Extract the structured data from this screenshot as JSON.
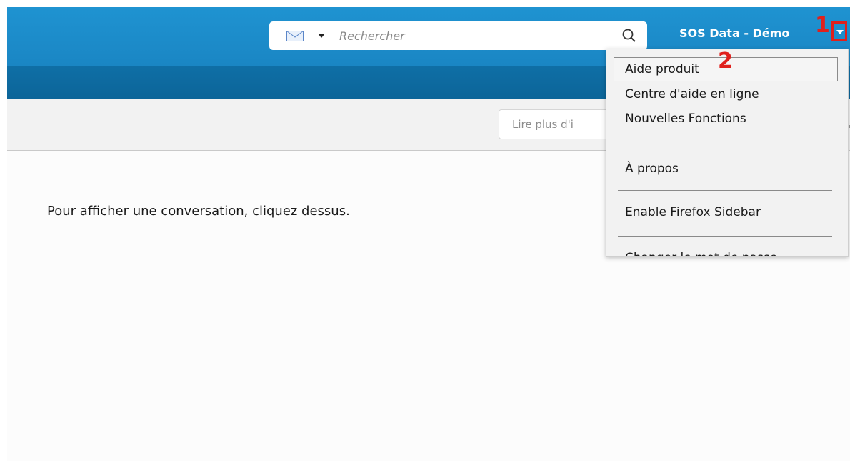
{
  "header": {
    "user_name": "SOS Data - Démo",
    "search": {
      "placeholder": "Rechercher",
      "scope_icon": "mail-icon"
    }
  },
  "annotations": {
    "step1": "1",
    "step2": "2",
    "color": "#e0201c"
  },
  "toolbar": {
    "read_more_label": "Lire plus d'i"
  },
  "main": {
    "empty_message": "Pour afficher une conversation, cliquez dessus."
  },
  "menu": {
    "items": [
      {
        "label": "Aide produit"
      },
      {
        "label": "Centre d'aide en ligne"
      },
      {
        "label": "Nouvelles Fonctions"
      },
      {
        "label": "À propos"
      },
      {
        "label": "Enable Firefox Sidebar"
      },
      {
        "label": "Changer le mot de passe"
      }
    ]
  },
  "colors": {
    "header": "#1f93d1",
    "subheader": "#0f6fa6",
    "toolbar": "#f2f2f2"
  }
}
